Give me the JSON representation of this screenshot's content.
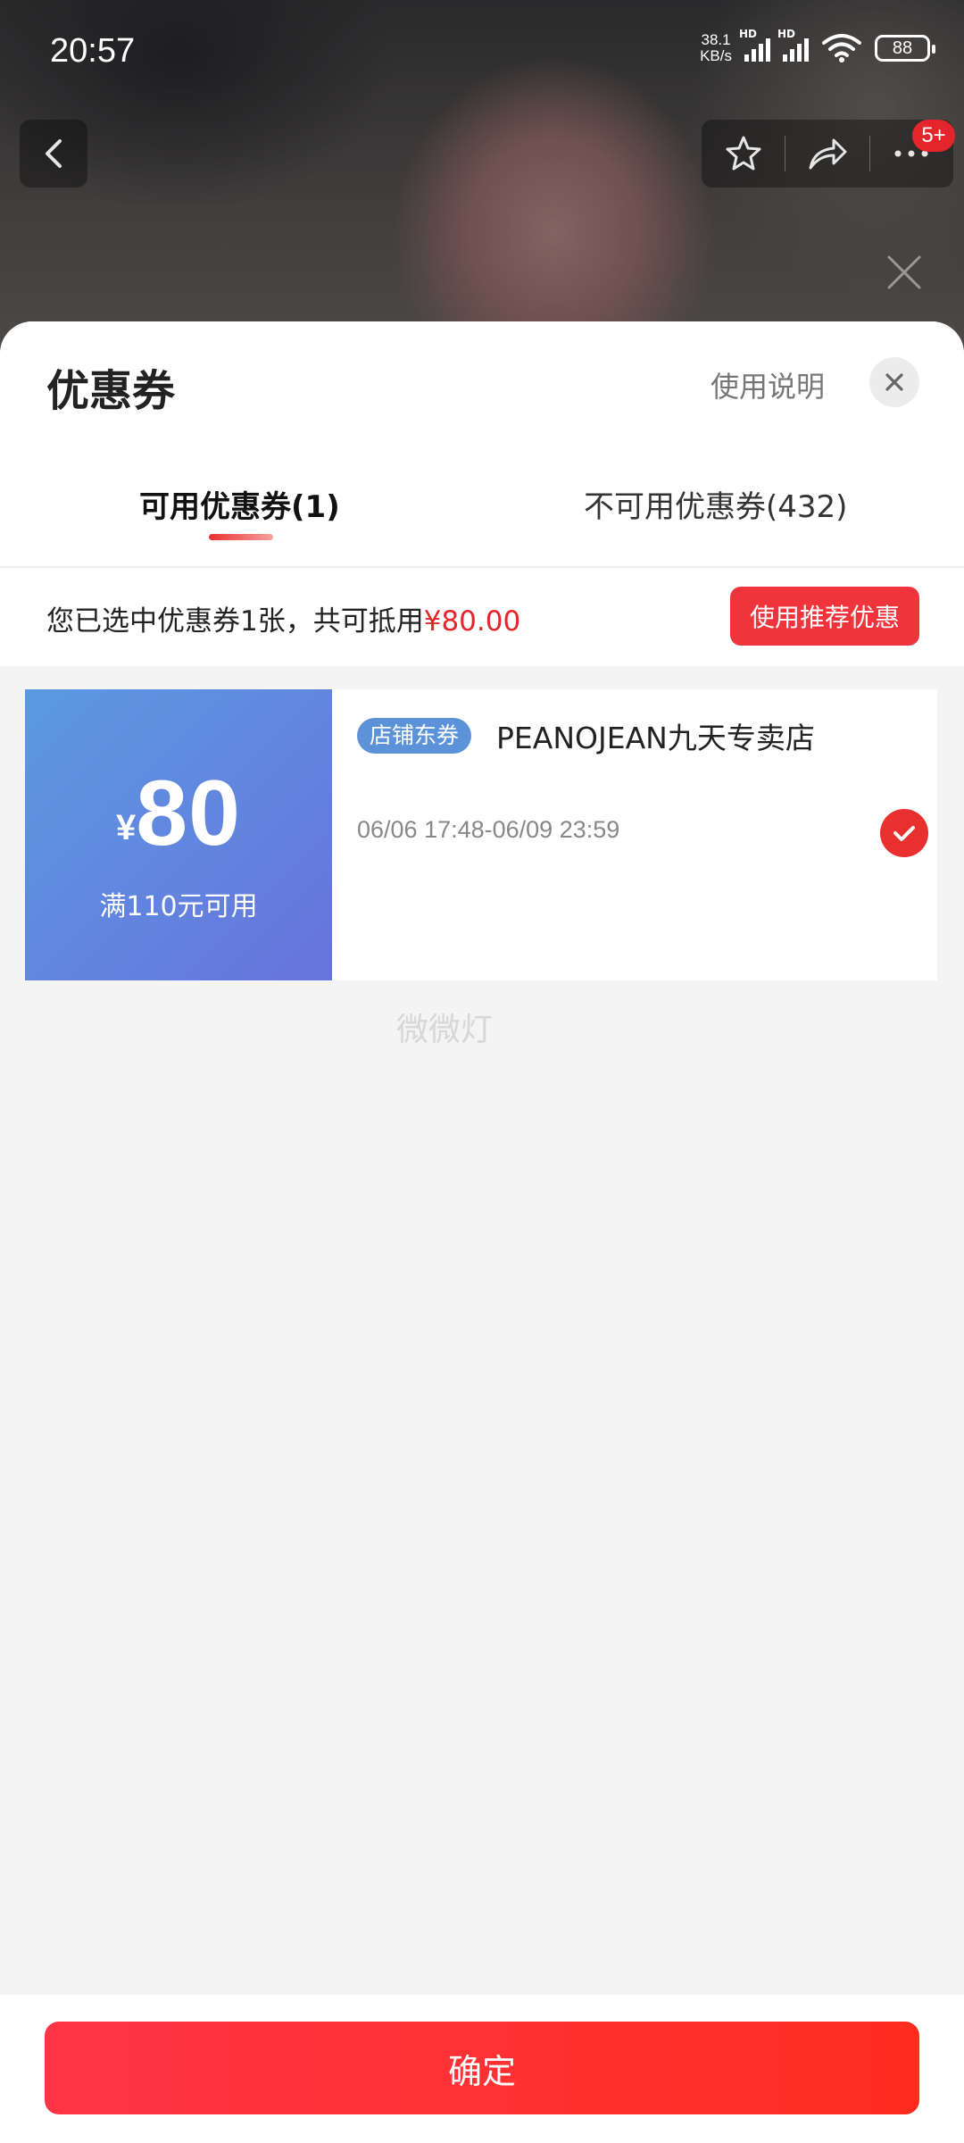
{
  "status_bar": {
    "time": "20:57",
    "net_speed_value": "38.1",
    "net_speed_unit": "KB/s",
    "signal_label": "HD",
    "battery": "88"
  },
  "product_nav": {
    "back_icon": "chevron-left-icon",
    "favorite_icon": "star-icon",
    "share_icon": "share-icon",
    "more_icon": "more-icon",
    "message_badge": "5+"
  },
  "sheet": {
    "title": "优惠券",
    "help_link": "使用说明",
    "tabs": [
      {
        "label": "可用优惠券(1)",
        "active": true
      },
      {
        "label": "不可用优惠券(432)",
        "active": false
      }
    ],
    "summary": {
      "text": "您已选中优惠券1张，共可抵用",
      "amount": "¥80.00",
      "recommend_button": "使用推荐优惠"
    },
    "coupons": [
      {
        "currency": "¥",
        "value": "80",
        "condition": "满110元可用",
        "tag": "店铺东券",
        "store": "PEANOJEAN九天专卖店",
        "validity": "06/06 17:48-06/09 23:59",
        "selected": true
      }
    ],
    "watermark": "微微灯",
    "confirm_button": "确定"
  },
  "colors": {
    "accent_red": "#e3262b",
    "coupon_blue_start": "#5b9ae2",
    "coupon_blue_end": "#6773dc"
  }
}
